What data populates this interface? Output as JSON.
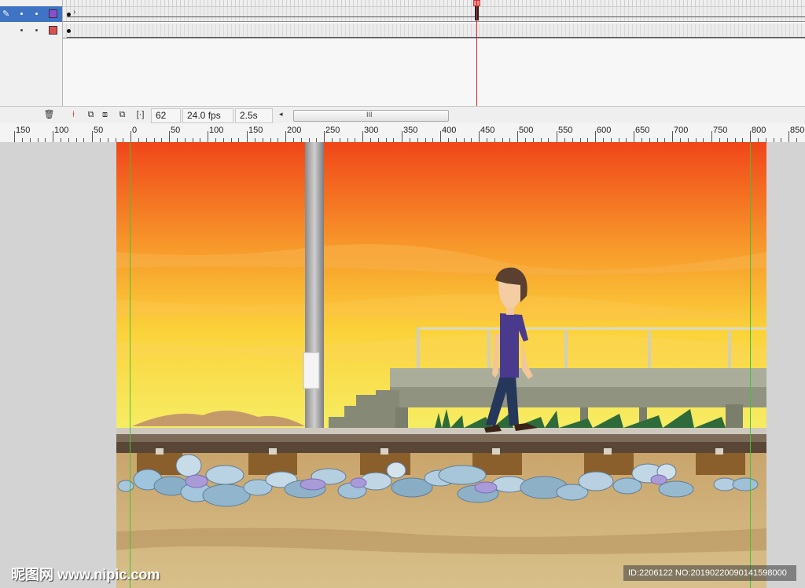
{
  "timeline": {
    "layers": [
      {
        "color": "#8a4fd0",
        "selected": true
      },
      {
        "color": "#e05050",
        "selected": false
      }
    ],
    "status": {
      "current_frame": "62",
      "frame_rate": "24.0 fps",
      "elapsed": "2.5s",
      "scroll_grip": "III"
    }
  },
  "ruler": {
    "labels": [
      "150",
      "100",
      "50",
      "0",
      "50",
      "100",
      "150",
      "200",
      "250",
      "300",
      "350",
      "400",
      "450",
      "500",
      "550",
      "600",
      "650",
      "700",
      "750",
      "800",
      "850"
    ]
  },
  "icons": {
    "pencil": "✎",
    "trash": "🗑",
    "scroll_left": "◂"
  },
  "watermark": {
    "left": "昵图网 www.nipic.com",
    "right": "ID:2206122 NO:20190220090141598000"
  },
  "colors": {
    "accent": "#3f73c4",
    "playhead": "#dd2222",
    "guide": "#37c837"
  }
}
